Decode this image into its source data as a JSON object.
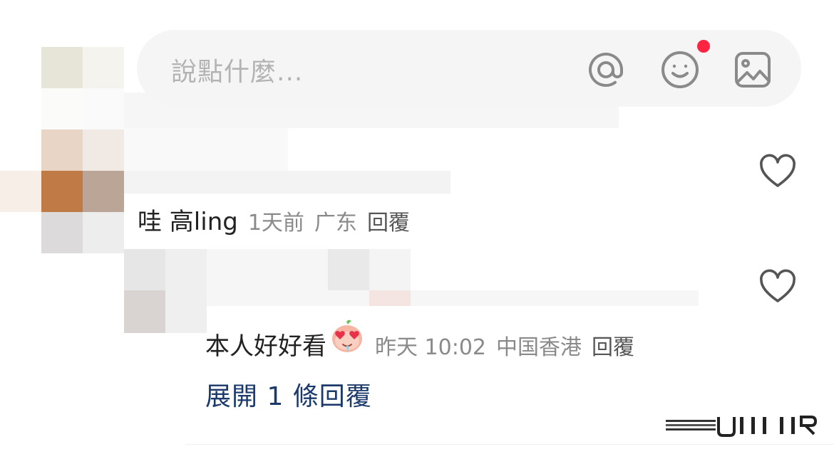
{
  "input": {
    "placeholder": "說點什麼..."
  },
  "icons": {
    "mention": "at-sign-icon",
    "emoji": "smile-icon",
    "image": "image-icon",
    "like": "heart-outline-icon",
    "inline_emoji": "heart-eyes-face-emoji"
  },
  "colors": {
    "badge": "#ff2442",
    "link": "#1b3a6b",
    "meta": "#8a8a8a"
  },
  "comments": [
    {
      "username": "哇 高ling",
      "time": "1天前",
      "location": "广东",
      "reply_label": "回覆"
    },
    {
      "text": "本人好好看",
      "time": "昨天 10:02",
      "location": "中国香港",
      "reply_label": "回覆",
      "expand_label": "展開 1 條回覆"
    }
  ]
}
